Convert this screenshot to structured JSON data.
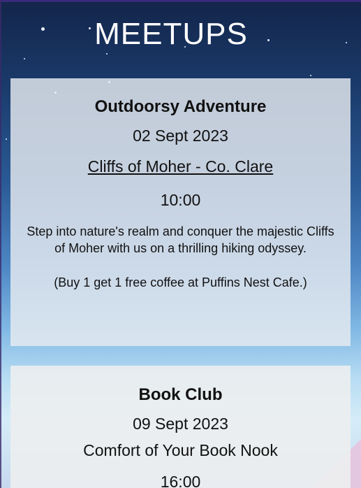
{
  "page": {
    "title": "MEETUPS"
  },
  "colors": {
    "sky_top": "#13254a",
    "sky_bottom": "#d5ecf8",
    "card_bg": "#e8ecf0",
    "text": "#111111",
    "title": "#ffffff"
  },
  "meetups": [
    {
      "name": "Outdoorsy Adventure",
      "date": "02 Sept 2023",
      "location": "Cliffs of Moher - Co. Clare",
      "time": "10:00",
      "description": "Step into nature's realm and conquer the majestic Cliffs of Moher with us on a thrilling hiking odyssey.",
      "note": "(Buy 1 get 1 free coffee at Puffins Nest Cafe.)"
    },
    {
      "name": "Book Club",
      "date": "09 Sept 2023",
      "location": "Comfort of Your Book Nook",
      "time": "16:00"
    }
  ]
}
